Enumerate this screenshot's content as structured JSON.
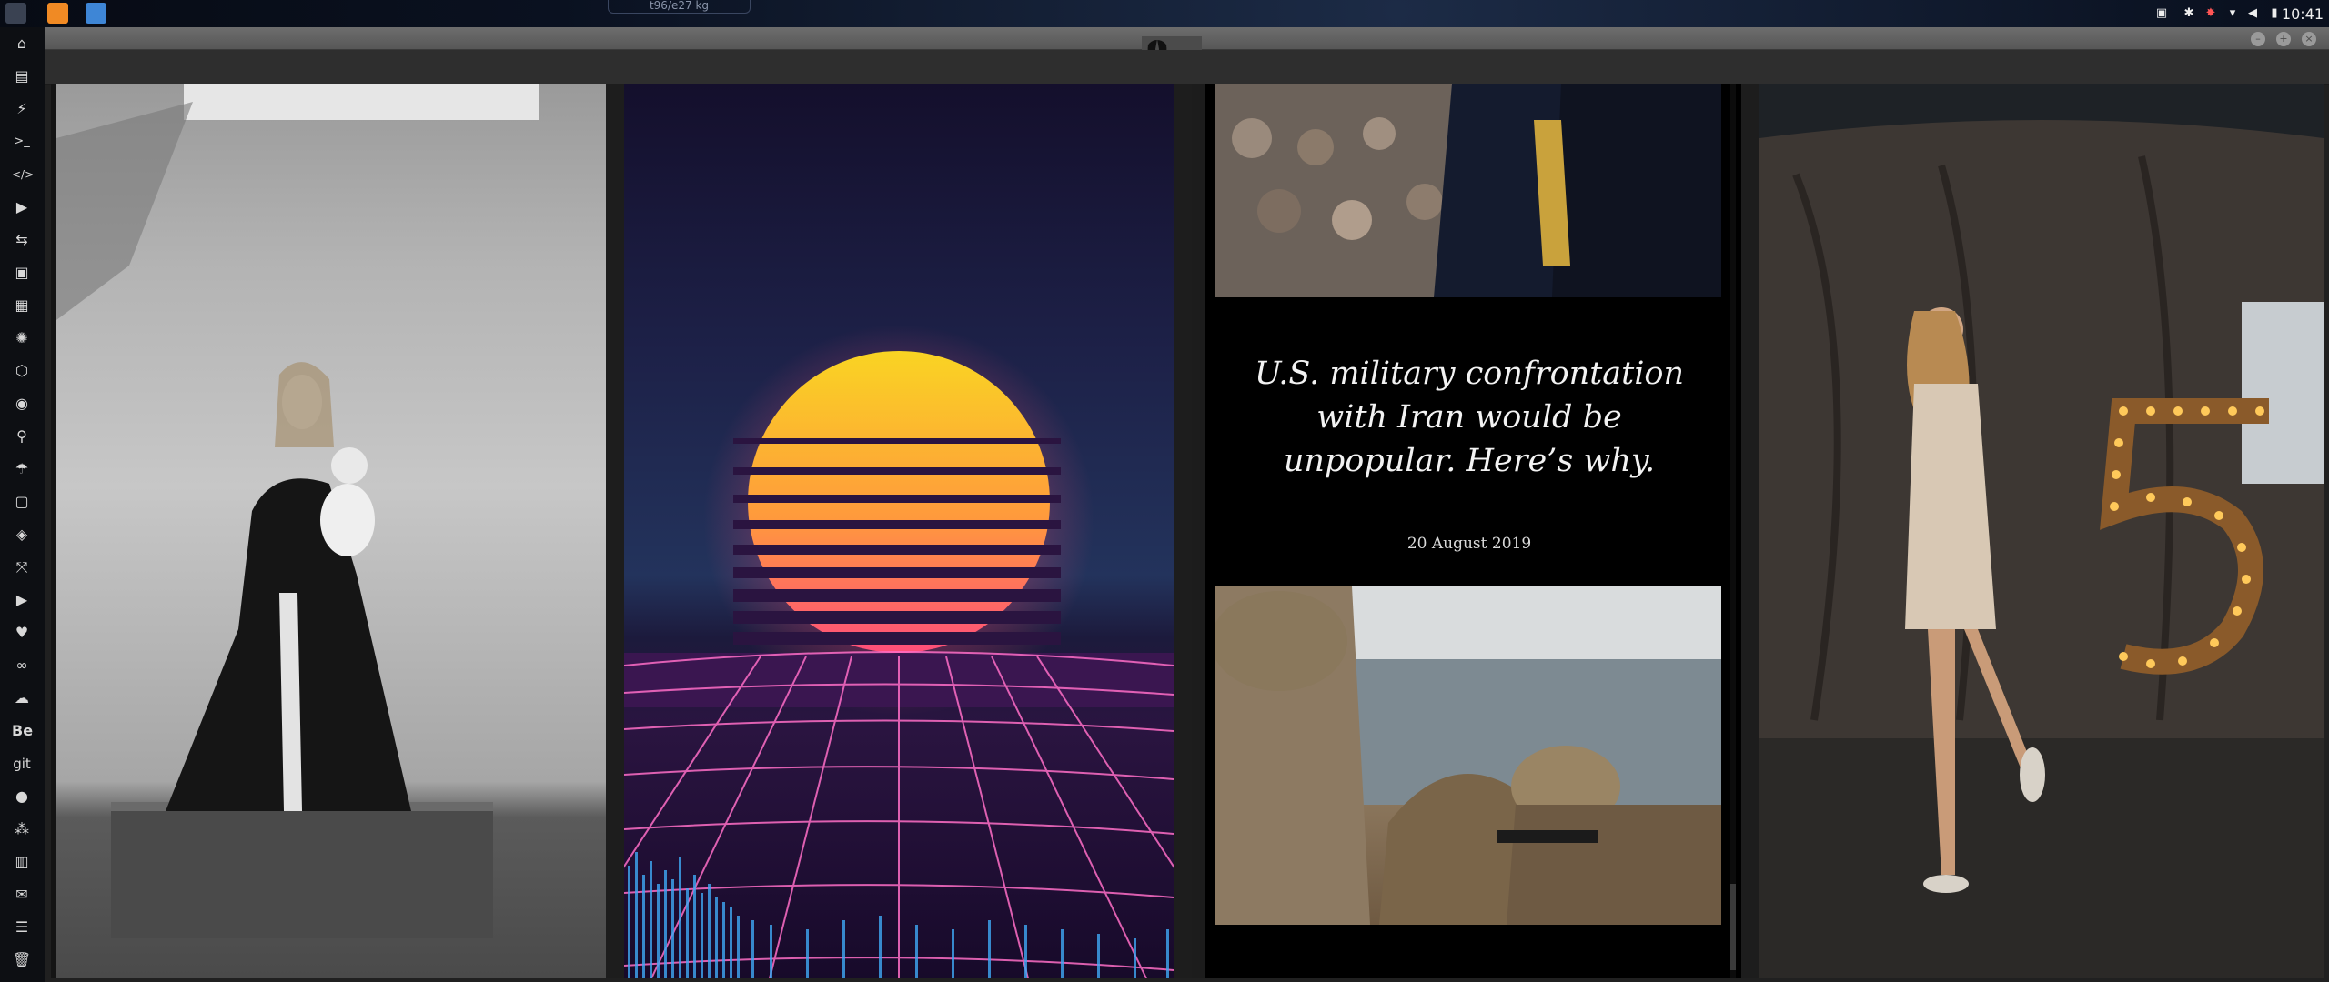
{
  "topbar": {
    "search_text": "t96/e27 kg",
    "clock": "10:41",
    "tray_icons": [
      "screenshot-icon",
      "bluetooth-icon",
      "alert-icon",
      "wifi-icon",
      "volume-icon",
      "power-icon"
    ]
  },
  "dock": {
    "items": [
      "home-icon",
      "document-icon",
      "bolt-icon",
      "terminal-icon",
      "code-icon",
      "play-icon",
      "translate-icon",
      "image-icon",
      "news-icon",
      "settings-icon",
      "hexagon-icon",
      "globe-icon",
      "search-icon",
      "umbrella-icon",
      "contact-icon",
      "tag-icon",
      "expand-icon",
      "youtube-icon",
      "heart-icon",
      "cloud-link-icon",
      "cloud-icon",
      "behance-icon",
      "git-icon",
      "github-icon",
      "network-icon",
      "map-icon",
      "mail-icon",
      "server-icon",
      "trash-icon"
    ],
    "labels": {
      "behance": "Be",
      "git": "git"
    }
  },
  "window": {
    "emblem": "rebel-alliance-icon"
  },
  "article": {
    "headline": "U.S. military confrontation with Iran would be unpopular. Here’s why.",
    "date": "20 August 2019"
  },
  "colors": {
    "sun_top": "#f9d423",
    "sun_bottom": "#ff4e7a",
    "grid": "#ff6ec7",
    "eq_bars": "#3fa9f5"
  }
}
